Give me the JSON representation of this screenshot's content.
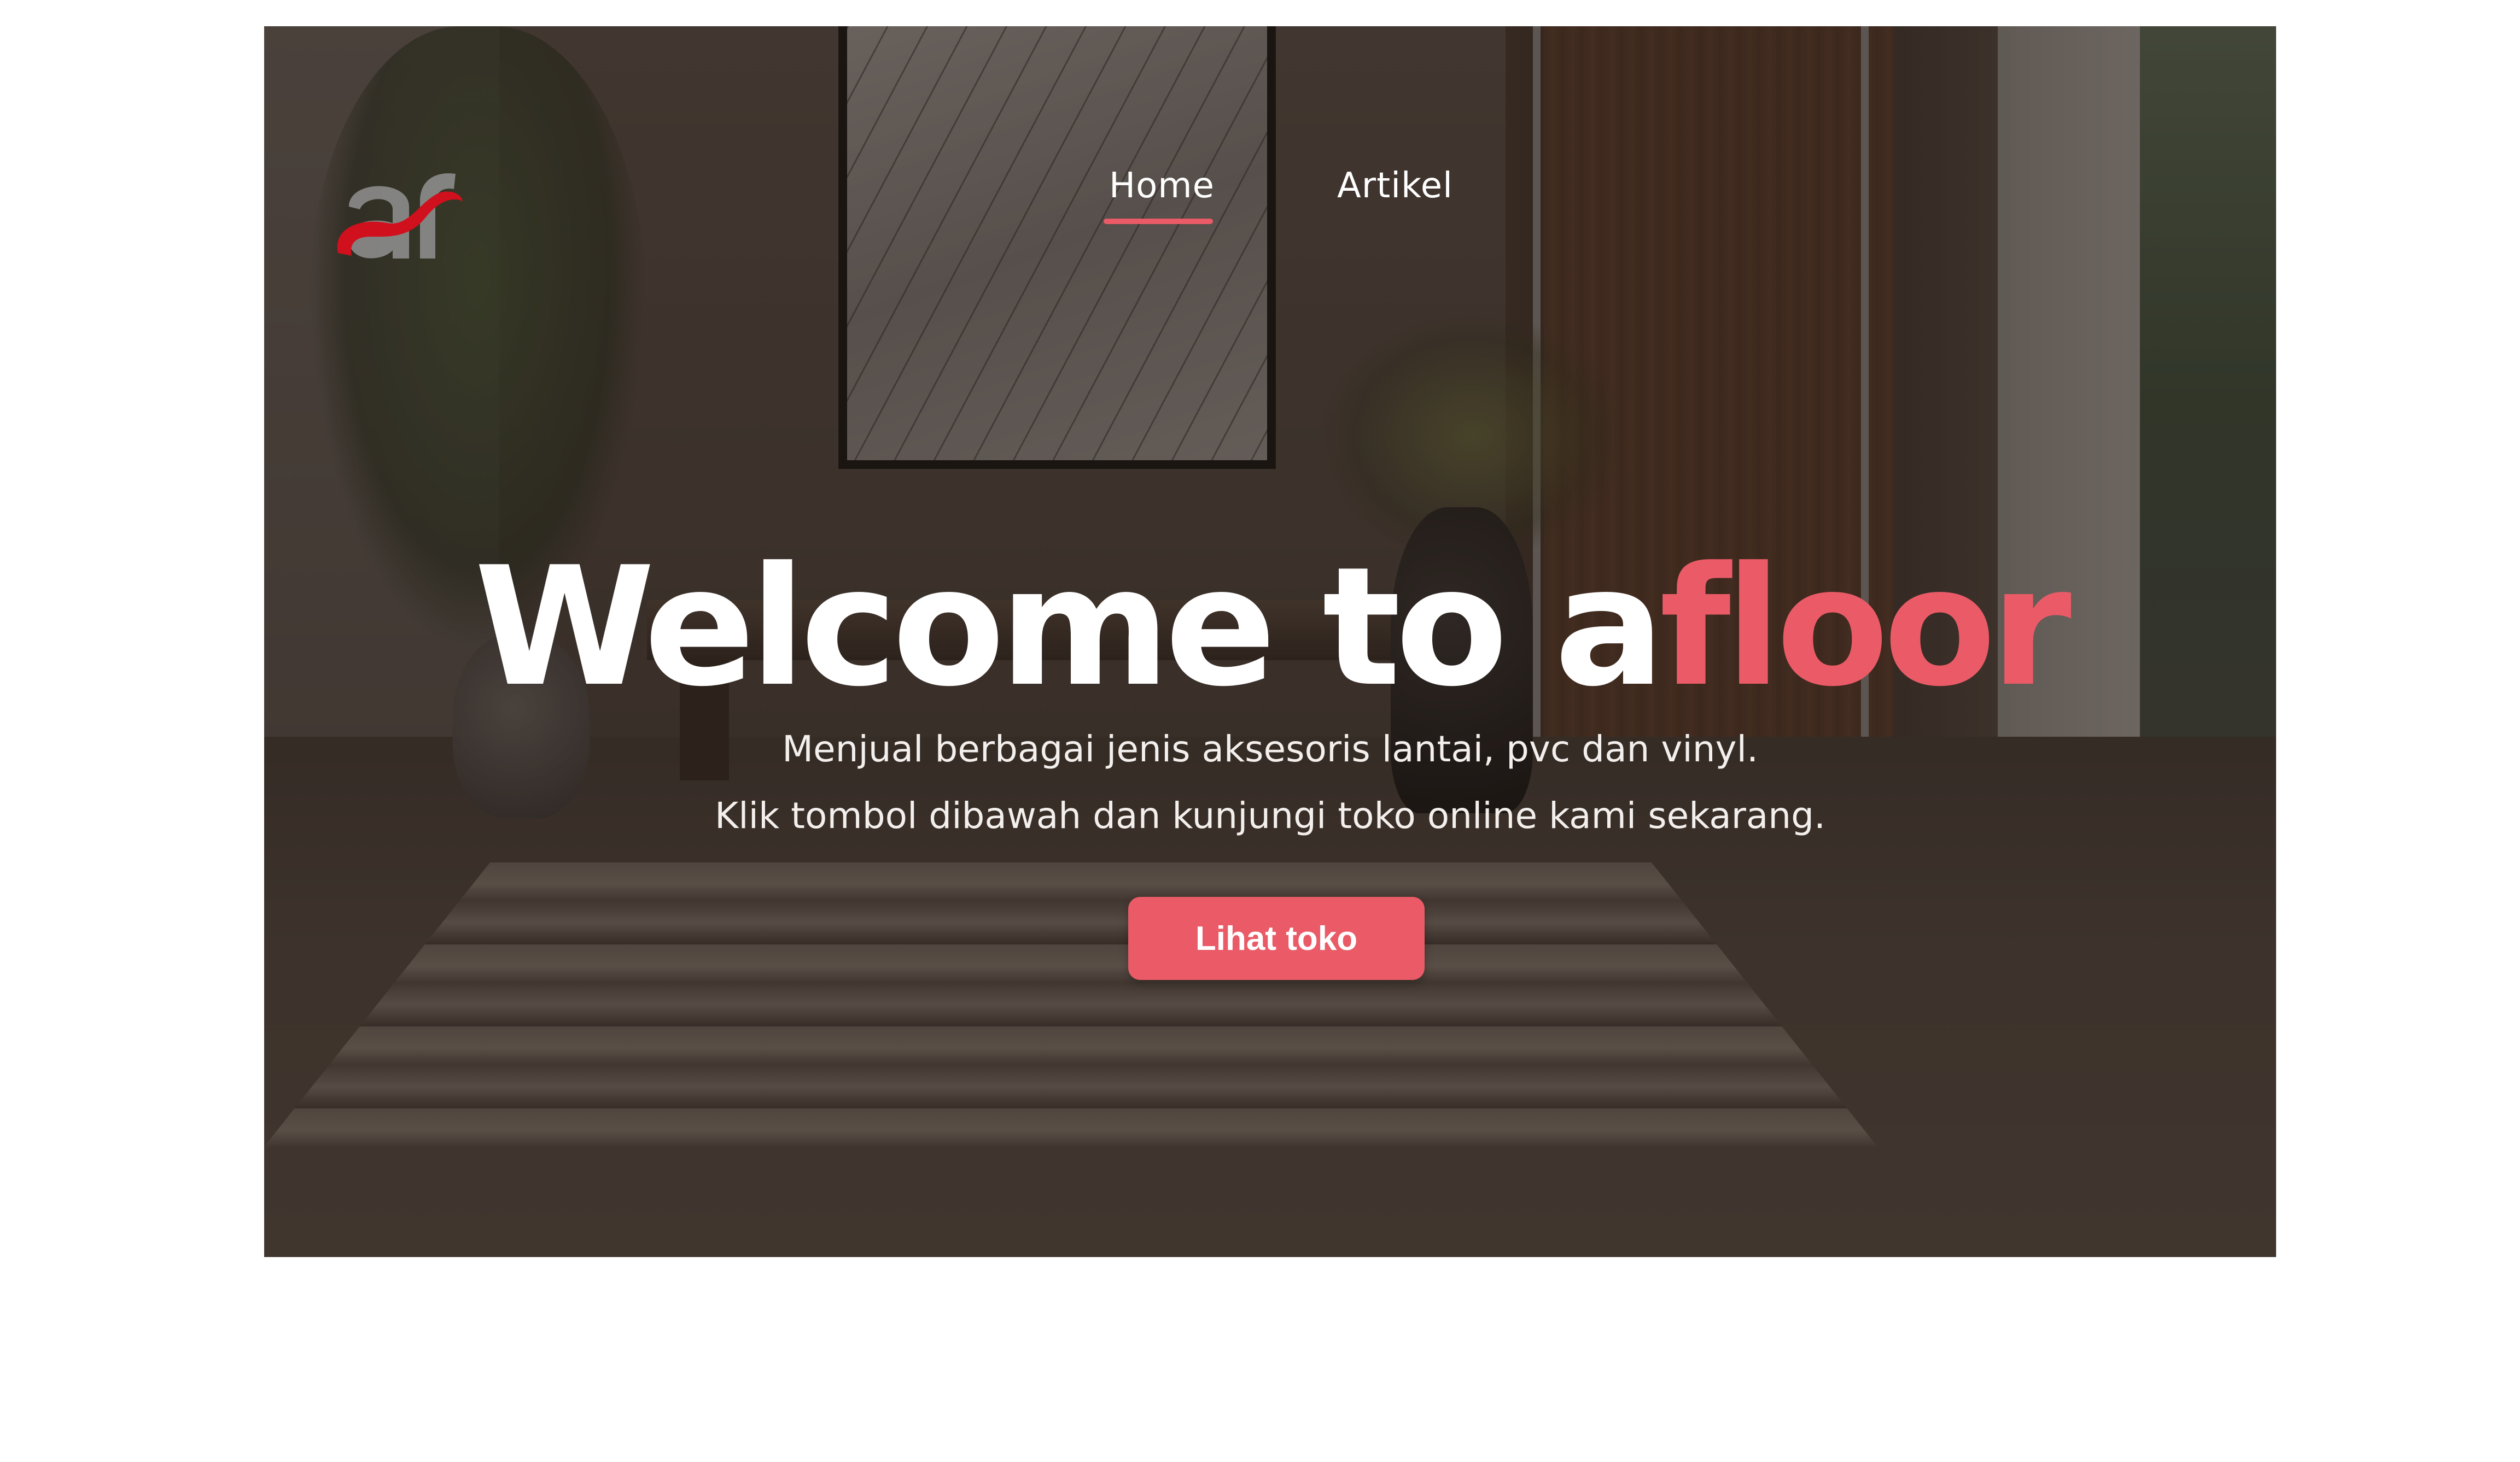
{
  "brand": {
    "logo_text": "af",
    "logo_color_primary": "#d0101c",
    "logo_color_secondary": "#8c8c8c"
  },
  "nav": {
    "items": [
      {
        "label": "Home",
        "active": true
      },
      {
        "label": "Artikel",
        "active": false
      }
    ]
  },
  "hero": {
    "headline_part1": "Welcome to a",
    "headline_part2": "floor",
    "subtitle_line1": "Menjual berbagai jenis aksesoris lantai, pvc dan vinyl.",
    "subtitle_line2": "Klik tombol dibawah dan kunjungi toko online kami sekarang.",
    "cta_label": "Lihat toko"
  },
  "colors": {
    "accent": "#ea5b67",
    "text_light": "#ffffff",
    "page_background": "#ffffff"
  }
}
